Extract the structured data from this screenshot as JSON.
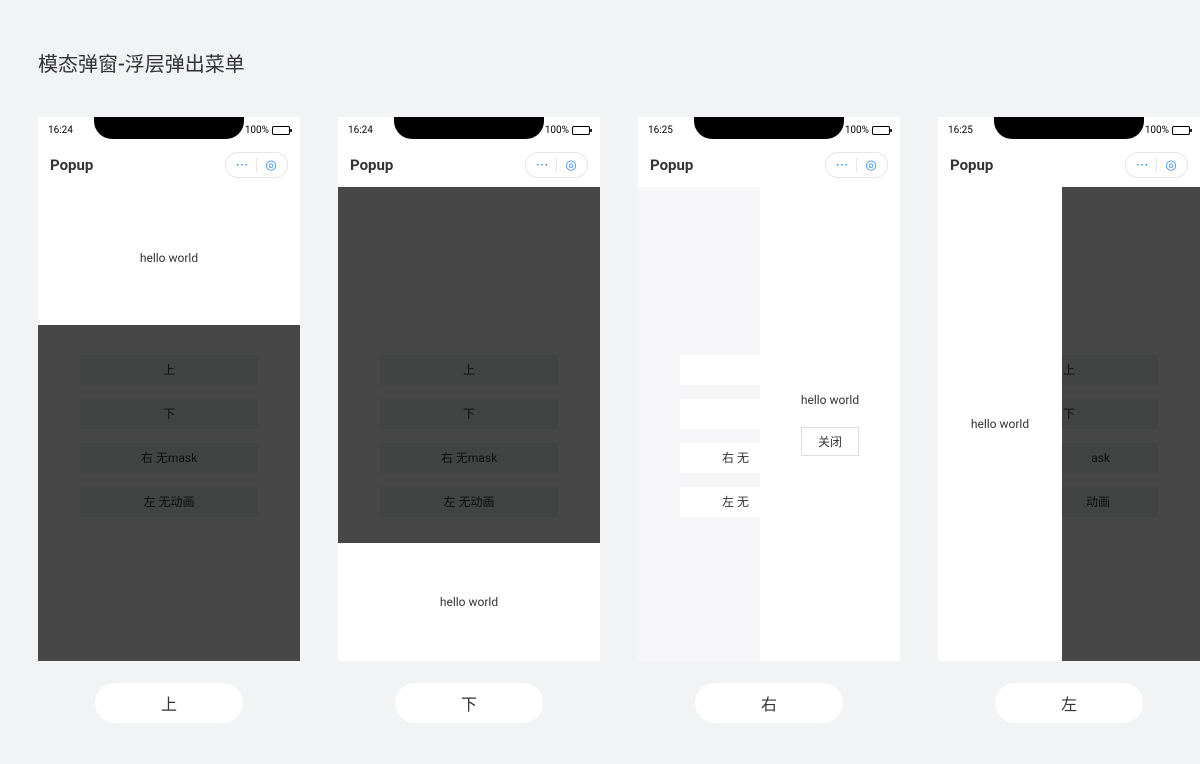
{
  "title": "模态弹窗-浮层弹出菜单",
  "nav_title": "Popup",
  "battery": "100%",
  "hello": "hello world",
  "close": "关闭",
  "buttons": {
    "up": "上",
    "down": "下",
    "right_nomask": "右 无mask",
    "left_noanim": "左 无动画",
    "right_cut": "右 无",
    "left_cut": "左 无"
  },
  "demos": [
    {
      "time": "16:24",
      "caption": "上"
    },
    {
      "time": "16:24",
      "caption": "下"
    },
    {
      "time": "16:25",
      "caption": "右"
    },
    {
      "time": "16:25",
      "caption": "左"
    }
  ]
}
